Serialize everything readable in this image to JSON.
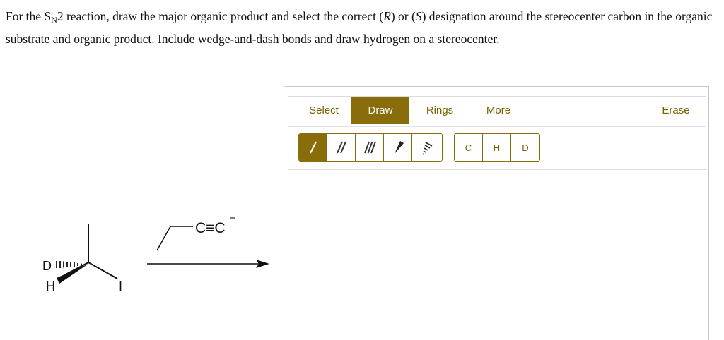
{
  "question": {
    "part1": "For the S",
    "sub": "N",
    "part2": "2 reaction, draw the major organic product and select the correct (",
    "r": "R",
    "part3": ") or (",
    "s": "S",
    "part4": ") designation around the stereocenter carbon in the organic substrate and organic product. Include wedge-and-dash bonds and draw hydrogen on a stereocenter."
  },
  "scheme": {
    "atom_d": "D",
    "atom_h": "H",
    "atom_i": "I",
    "reagent": "C≡C",
    "charge": "−"
  },
  "editor": {
    "tabs": {
      "select": "Select",
      "draw": "Draw",
      "rings": "Rings",
      "more": "More",
      "erase": "Erase"
    },
    "atoms": {
      "c": "C",
      "h": "H",
      "d": "D"
    }
  },
  "colors": {
    "accent": "#8a6d0b",
    "accent_text": "#7a6000"
  }
}
